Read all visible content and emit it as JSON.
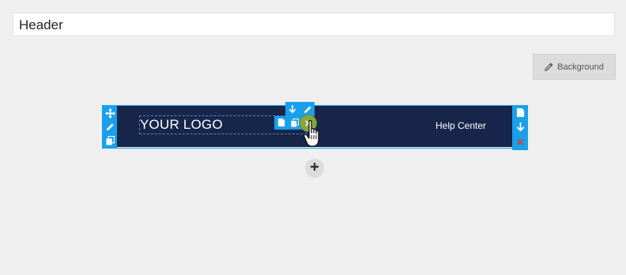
{
  "header_field": {
    "value": "Header"
  },
  "background_button": {
    "label": "Background",
    "icon": "pencil-icon"
  },
  "banner": {
    "logo_text": "YOUR LOGO",
    "help_link": "Help Center",
    "background_color": "#17264a"
  },
  "toolbar": {
    "accent_color": "#19a0ec",
    "left_icons": [
      "move-icon",
      "edit-icon",
      "copy-icon"
    ],
    "right_icons": [
      "paste-icon",
      "move-down-icon",
      "delete-icon"
    ],
    "element_icons": [
      "move-down-icon",
      "edit-icon",
      "paste-icon",
      "copy-icon",
      "delete-icon"
    ]
  },
  "add_button": {
    "icon": "plus-icon"
  }
}
